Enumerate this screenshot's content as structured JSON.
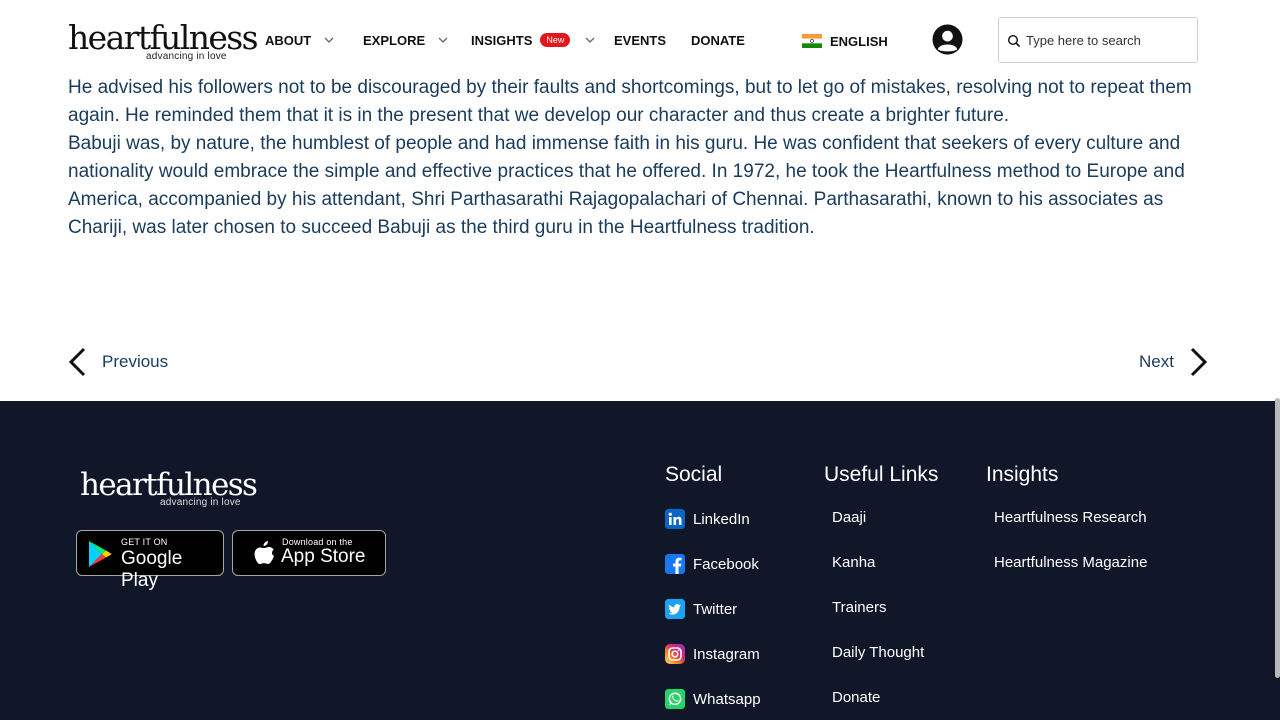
{
  "header": {
    "logo_word": "heartfulness",
    "logo_tagline": "advancing in love",
    "nav": [
      {
        "label": "ABOUT",
        "has_dropdown": true
      },
      {
        "label": "EXPLORE",
        "has_dropdown": true
      },
      {
        "label": "INSIGHTS",
        "badge": "New",
        "has_dropdown": true
      },
      {
        "label": "EVENTS",
        "has_dropdown": false
      },
      {
        "label": "DONATE",
        "has_dropdown": false
      }
    ],
    "language": "ENGLISH",
    "search_placeholder": "Type here to search"
  },
  "article": {
    "paragraphs": [
      "He advised his followers not to be discouraged by their faults and shortcomings, but to let go of mistakes, resolving not to repeat them again. He reminded them that it is in the present that we develop our character and thus create a brighter future.",
      "Babuji was, by nature, the humblest of people and had immense faith in his guru. He was confident that seekers of every culture and nationality would embrace the simple and effective practices that he offered. In 1972, he took the Heartfulness method to Europe and America, accompanied by his attendant, Shri Parthasarathi Rajagopalachari of Chennai. Parthasarathi, known to his associates as Chariji, was later chosen to succeed Babuji as the third guru in the Heartfulness tradition."
    ]
  },
  "pager": {
    "previous": "Previous",
    "next": "Next"
  },
  "footer": {
    "logo_word": "heartfulness",
    "logo_tagline": "advancing in love",
    "google_play": {
      "small": "GET IT ON",
      "big": "Google Play"
    },
    "app_store": {
      "small": "Download on the",
      "big": "App Store"
    },
    "social": {
      "title": "Social",
      "links": [
        {
          "label": "LinkedIn",
          "icon": "linkedin-icon",
          "color": "#0a66c2"
        },
        {
          "label": "Facebook",
          "icon": "facebook-icon",
          "color": "#1877f2"
        },
        {
          "label": "Twitter",
          "icon": "twitter-icon",
          "color": "#1da1f2"
        },
        {
          "label": "Instagram",
          "icon": "instagram-icon",
          "color": "#e1306c"
        },
        {
          "label": "Whatsapp",
          "icon": "whatsapp-icon",
          "color": "#25d366"
        }
      ]
    },
    "useful_links": {
      "title": "Useful Links",
      "links": [
        "Daaji",
        "Kanha",
        "Trainers",
        "Daily Thought",
        "Donate"
      ]
    },
    "insights": {
      "title": "Insights",
      "links": [
        "Heartfulness Research",
        "Heartfulness Magazine"
      ]
    }
  },
  "colors": {
    "text_primary": "#1a3b5c",
    "footer_bg": "#0f1729",
    "badge_red": "#e3161c"
  }
}
